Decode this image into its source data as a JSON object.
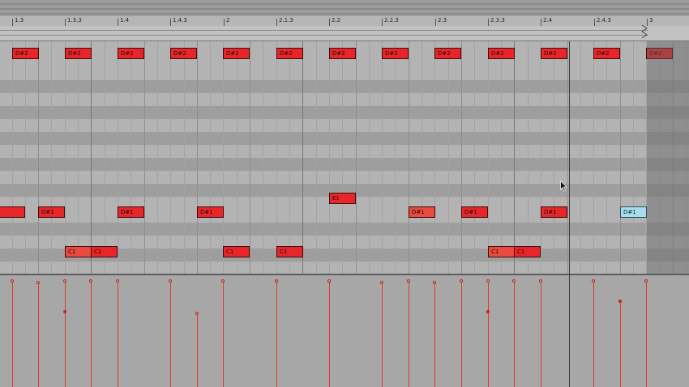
{
  "ruler": {
    "labels": [
      "1.3",
      "1.3.3",
      "1.4",
      "1.4.3",
      "2",
      "2.1.3",
      "2.2",
      "2.2.3",
      "2.3",
      "2.3.3",
      "2.4",
      "2.4.3",
      "3"
    ]
  },
  "notes": [
    {
      "label": "D#2",
      "row": "d2"
    },
    {
      "label": "D#2",
      "row": "d2"
    },
    {
      "label": "D#2",
      "row": "d2"
    },
    {
      "label": "D#2",
      "row": "d2"
    },
    {
      "label": "D#2",
      "row": "d2"
    },
    {
      "label": "D#2",
      "row": "d2"
    },
    {
      "label": "D#2",
      "row": "d2"
    },
    {
      "label": "D#2",
      "row": "d2"
    },
    {
      "label": "D#2",
      "row": "d2"
    },
    {
      "label": "D#2",
      "row": "d2"
    },
    {
      "label": "D#2",
      "row": "d2"
    },
    {
      "label": "D#2",
      "row": "d2"
    },
    {
      "label": "D#2",
      "row": "d2"
    },
    {
      "label": "",
      "row": "d1"
    },
    {
      "label": "D#1",
      "row": "d1"
    },
    {
      "label": "D#1",
      "row": "d1"
    },
    {
      "label": "D#1",
      "row": "d1"
    },
    {
      "label": "D#1",
      "row": "d1"
    },
    {
      "label": "D#1",
      "row": "d1"
    },
    {
      "label": "D#1",
      "row": "d1"
    },
    {
      "label": "D#1",
      "row": "d1",
      "selected": true
    },
    {
      "label": "E1",
      "row": "e1"
    },
    {
      "label": "C1",
      "row": "c1"
    },
    {
      "label": "C1",
      "row": "c1"
    },
    {
      "label": "C1",
      "row": "c1"
    },
    {
      "label": "C1",
      "row": "c1"
    },
    {
      "label": "C1",
      "row": "c1"
    },
    {
      "label": "C1",
      "row": "c1"
    }
  ],
  "colors": {
    "note": "#e8262a",
    "note_selected": "#a9dcef",
    "velocity": "#e23a2e",
    "background": "#a9a9a9"
  },
  "icons": {
    "cursor": "mouse-pointer-icon",
    "loop_end": "loop-end-marker-icon"
  }
}
